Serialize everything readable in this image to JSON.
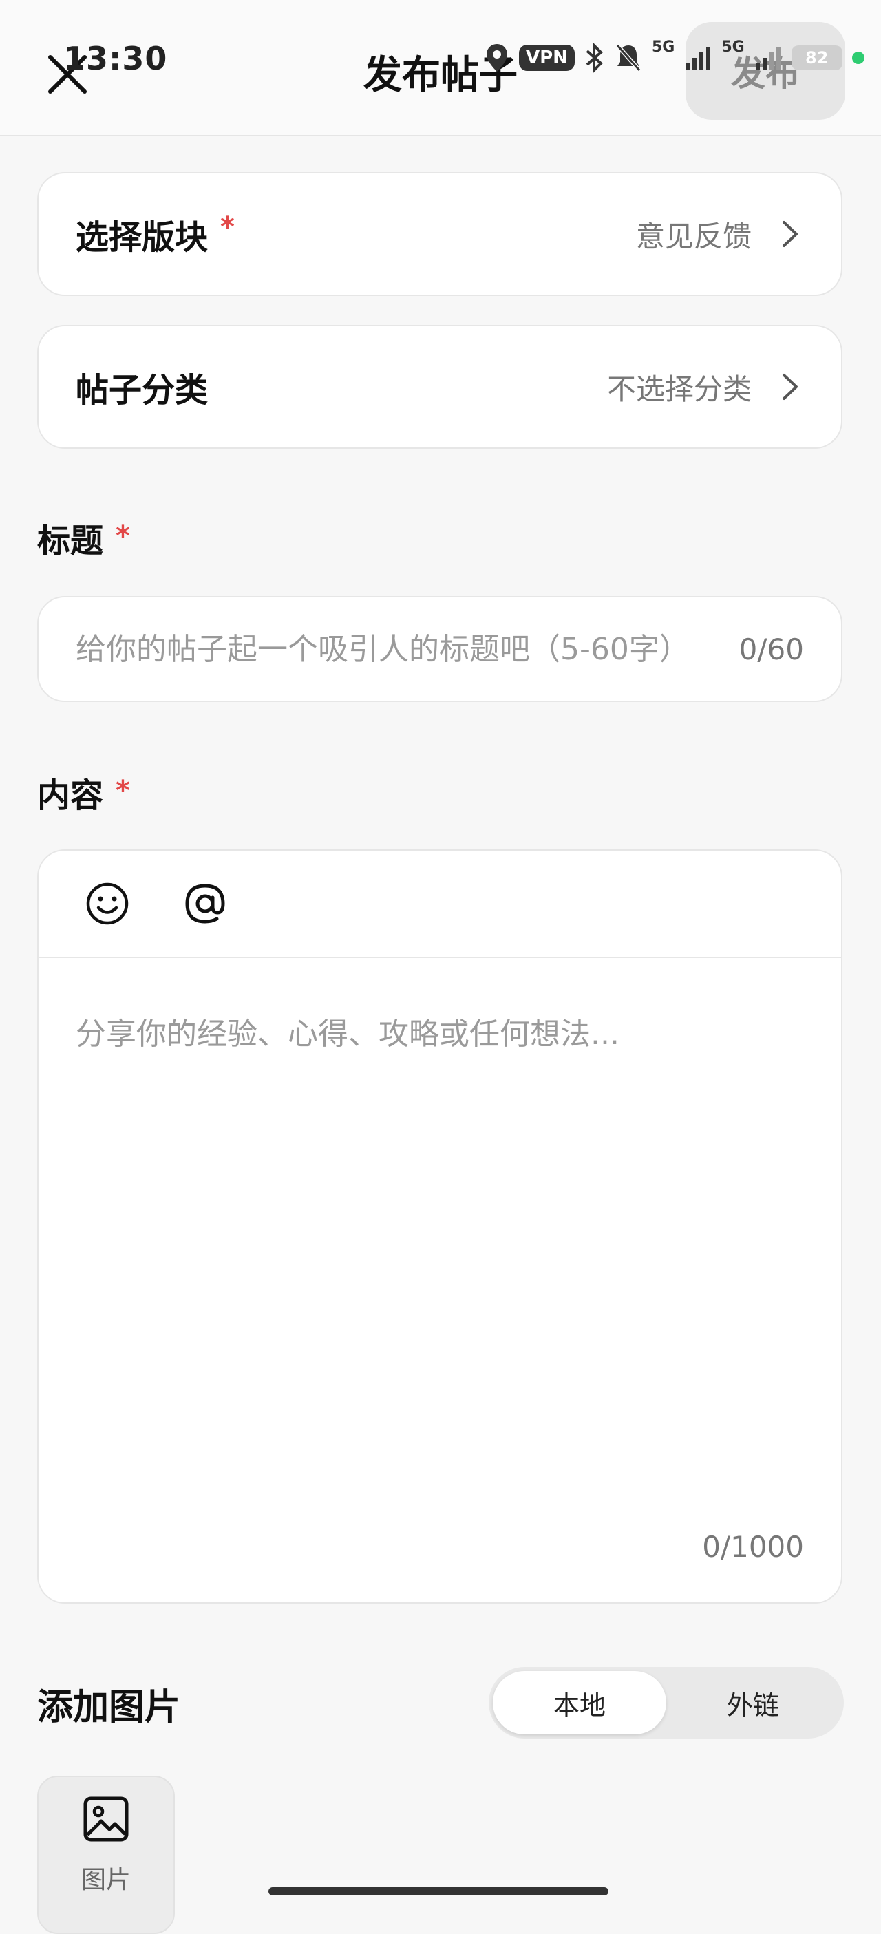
{
  "status_bar": {
    "time": "13:30",
    "vpn_label": "VPN",
    "network_1": "5G",
    "network_2": "5G",
    "battery": "82"
  },
  "header": {
    "title": "发布帖子",
    "publish_label": "发布"
  },
  "board_row": {
    "label": "选择版块",
    "required_mark": "*",
    "value": "意见反馈"
  },
  "category_row": {
    "label": "帖子分类",
    "value": "不选择分类"
  },
  "title_section": {
    "label": "标题",
    "required_mark": "*",
    "placeholder": "给你的帖子起一个吸引人的标题吧（5-60字）",
    "value": "",
    "count": "0/60"
  },
  "content_section": {
    "label": "内容",
    "required_mark": "*",
    "placeholder": "分享你的经验、心得、攻略或任何想法...",
    "value": "",
    "count": "0/1000"
  },
  "images_section": {
    "label": "添加图片",
    "tabs": [
      {
        "label": "本地",
        "active": true
      },
      {
        "label": "外链",
        "active": false
      }
    ],
    "tile_label": "图片"
  },
  "colors": {
    "required": "#e24848",
    "status_dot": "#2ecc71"
  }
}
